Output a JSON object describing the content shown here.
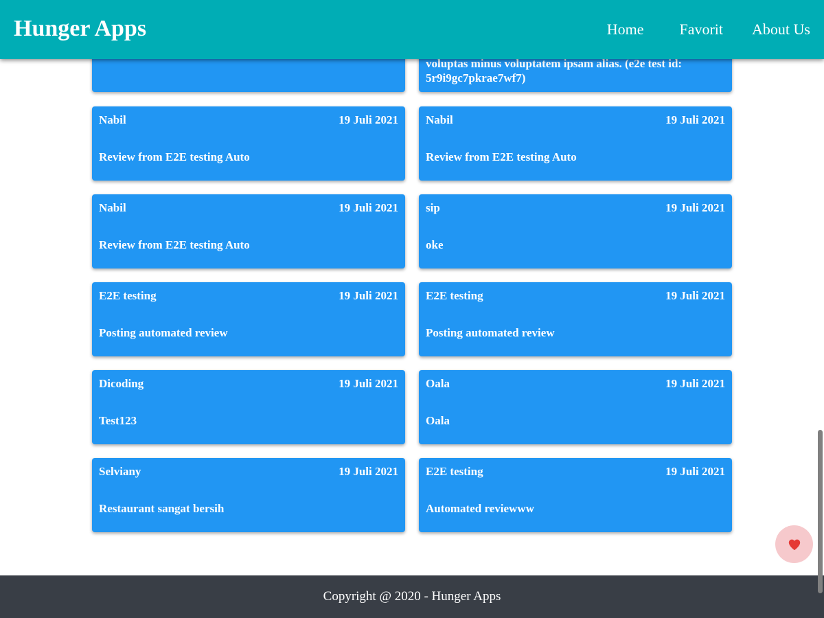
{
  "header": {
    "brand": "Hunger Apps",
    "nav": [
      "Home",
      "Favorit",
      "About Us"
    ]
  },
  "partial_review": {
    "text": "voluptas minus voluptatem ipsam alias. (e2e test id: 5r9i9gc7pkrae7wf7)"
  },
  "reviews": [
    {
      "name": "Nabil",
      "date": "19 Juli 2021",
      "review": "Review from E2E testing Auto"
    },
    {
      "name": "Nabil",
      "date": "19 Juli 2021",
      "review": "Review from E2E testing Auto"
    },
    {
      "name": "Nabil",
      "date": "19 Juli 2021",
      "review": "Review from E2E testing Auto"
    },
    {
      "name": "sip",
      "date": "19 Juli 2021",
      "review": "oke"
    },
    {
      "name": "E2E testing",
      "date": "19 Juli 2021",
      "review": "Posting automated review"
    },
    {
      "name": "E2E testing",
      "date": "19 Juli 2021",
      "review": "Posting automated review"
    },
    {
      "name": "Dicoding",
      "date": "19 Juli 2021",
      "review": "Test123"
    },
    {
      "name": "Oala",
      "date": "19 Juli 2021",
      "review": "Oala"
    },
    {
      "name": "Selviany",
      "date": "19 Juli 2021",
      "review": "Restaurant sangat bersih"
    },
    {
      "name": "E2E testing",
      "date": "19 Juli 2021",
      "review": "Automated reviewww"
    }
  ],
  "favorite_button": {
    "icon": "heart-icon",
    "color": "#e53935"
  },
  "footer": {
    "text": "Copyright @ 2020 - Hunger Apps"
  },
  "colors": {
    "header": "#00adb5",
    "card": "#2196f3",
    "footer": "#393e46"
  }
}
